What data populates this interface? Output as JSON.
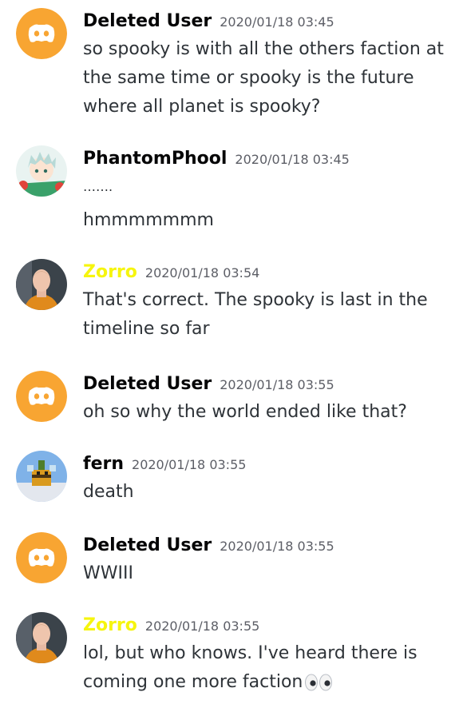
{
  "colors": {
    "discord_orange": "#f8a532",
    "author_default": "#060607",
    "author_zorro": "#f6f50e",
    "timestamp": "#5c5e66",
    "message_text": "#2e3338"
  },
  "messages": [
    {
      "author": "Deleted User",
      "timestamp": "2020/01/18 03:45",
      "avatar_icon": "discord-logo-icon",
      "lines": [
        "so spooky is with all the others faction at the same time or spooky is the future where all planet is spooky?"
      ]
    },
    {
      "author": "PhantomPhool",
      "timestamp": "2020/01/18 03:45",
      "avatar_icon": "anime-character-avatar",
      "lines": [
        "…….",
        "hmmmmmmm"
      ]
    },
    {
      "author": "Zorro",
      "timestamp": "2020/01/18 03:54",
      "avatar_icon": "person-photo-avatar",
      "lines": [
        "That's correct. The spooky is last in the timeline so far"
      ]
    },
    {
      "author": "Deleted User",
      "timestamp": "2020/01/18 03:55",
      "avatar_icon": "discord-logo-icon",
      "lines": [
        "oh so why the world ended like that?"
      ]
    },
    {
      "author": "fern",
      "timestamp": "2020/01/18 03:55",
      "avatar_icon": "pixel-bee-avatar",
      "lines": [
        "death"
      ]
    },
    {
      "author": "Deleted User",
      "timestamp": "2020/01/18 03:55",
      "avatar_icon": "discord-logo-icon",
      "lines": [
        "WWIII"
      ]
    },
    {
      "author": "Zorro",
      "timestamp": "2020/01/18 03:55",
      "avatar_icon": "person-photo-avatar",
      "lines": [
        "lol, but who knows. I've heard there is coming one more faction"
      ],
      "emoji": "eyes-emoji"
    }
  ]
}
